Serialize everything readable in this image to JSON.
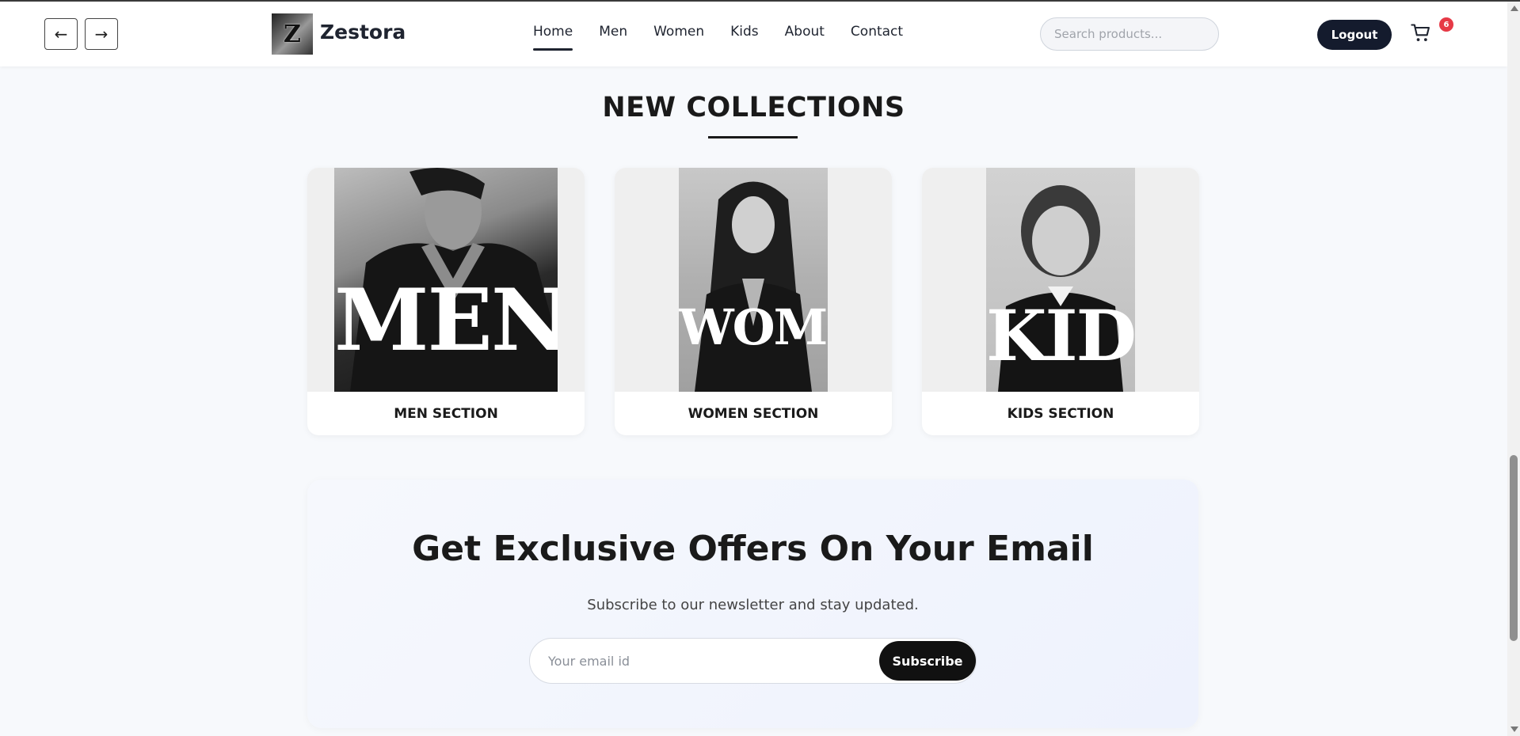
{
  "header": {
    "back_icon": "←",
    "forward_icon": "→",
    "logo_letter": "Z",
    "brand": "Zestora",
    "menu": [
      {
        "label": "Home",
        "active": true
      },
      {
        "label": "Men",
        "active": false
      },
      {
        "label": "Women",
        "active": false
      },
      {
        "label": "Kids",
        "active": false
      },
      {
        "label": "About",
        "active": false
      },
      {
        "label": "Contact",
        "active": false
      }
    ],
    "search_placeholder": "Search products...",
    "logout_label": "Logout",
    "cart_icon": "cart-icon",
    "cart_count": "6",
    "badge_color": "#e63946"
  },
  "collections": {
    "title": "NEW COLLECTIONS",
    "cards": [
      {
        "image_word": "MEN",
        "label": "MEN SECTION"
      },
      {
        "image_word": "WOMEN",
        "label": "WOMEN SECTION"
      },
      {
        "image_word": "KID",
        "label": "KIDS SECTION"
      }
    ]
  },
  "newsletter": {
    "title": "Get Exclusive Offers On Your Email",
    "subtitle": "Subscribe to our newsletter and stay updated.",
    "email_placeholder": "Your email id",
    "button_label": "Subscribe"
  }
}
